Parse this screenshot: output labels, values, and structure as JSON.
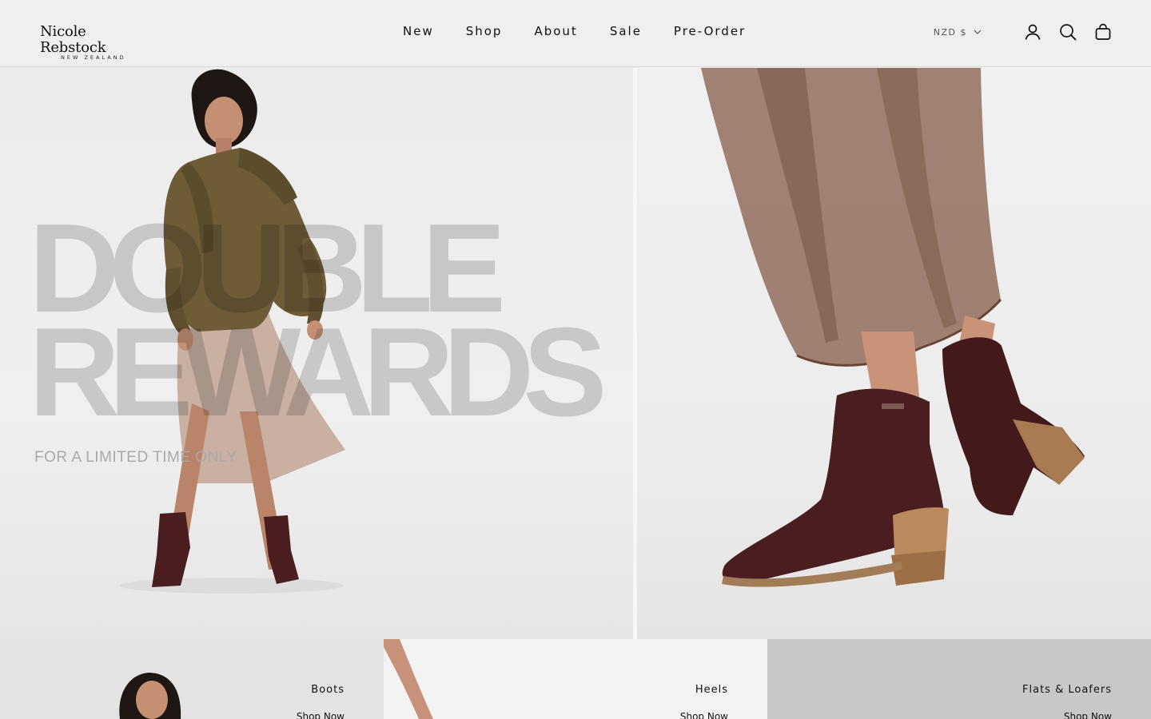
{
  "brand": {
    "name": "Nicole Rebstock",
    "subtitle": "NEW ZEALAND"
  },
  "nav": {
    "items": [
      {
        "label": "New"
      },
      {
        "label": "Shop"
      },
      {
        "label": "About"
      },
      {
        "label": "Sale"
      },
      {
        "label": "Pre-Order"
      }
    ]
  },
  "header": {
    "currency": "NZD $",
    "icons": [
      "account-icon",
      "search-icon",
      "cart-icon"
    ]
  },
  "hero": {
    "headline": "DOUBLE\nREWARDS",
    "subheadline": "FOR A LIMITED TIME ONLY"
  },
  "categories": [
    {
      "title": "Boots",
      "link": "Shop Now"
    },
    {
      "title": "Heels",
      "link": "Shop Now"
    },
    {
      "title": "Flats & Loafers",
      "link": "Shop Now"
    }
  ],
  "colors": {
    "background": "#efefef",
    "text": "#111111",
    "headline": "#d4d4d4",
    "boot": "#4a1e21",
    "jacket": "#6e5c36",
    "skirt": "#8a6150"
  }
}
